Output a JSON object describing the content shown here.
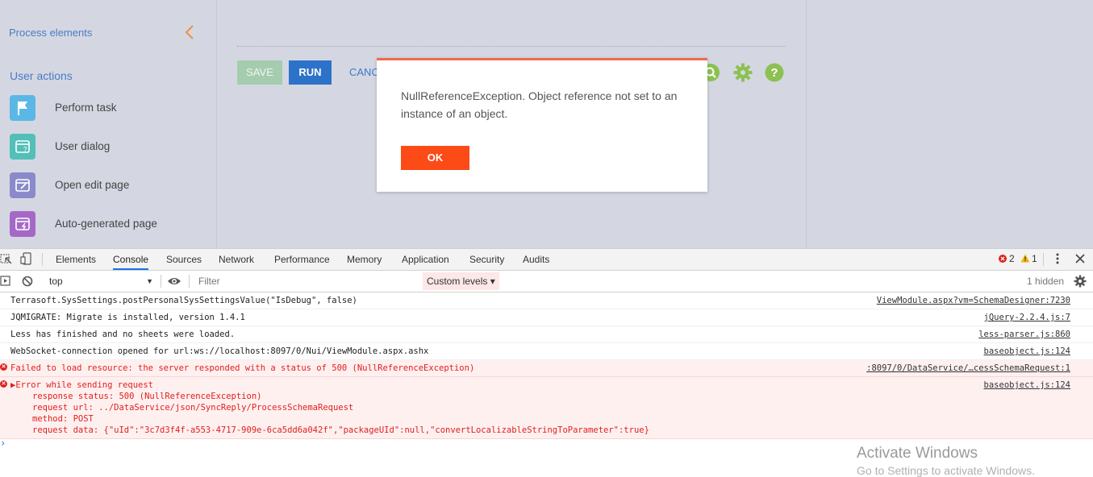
{
  "left_panel": {
    "title": "Process elements",
    "section": "User actions",
    "items": [
      {
        "label": "Perform task",
        "icon": "flag-icon",
        "color": "#5bb8e6"
      },
      {
        "label": "User dialog",
        "icon": "dialog-icon",
        "color": "#52bfb9"
      },
      {
        "label": "Open edit page",
        "icon": "edit-page-icon",
        "color": "#8a8acb"
      },
      {
        "label": "Auto-generated page",
        "icon": "autogen-page-icon",
        "color": "#a668c8"
      }
    ]
  },
  "toolbar": {
    "save_label": "SAVE",
    "run_label": "RUN",
    "cancel_label": "CANC",
    "icons": [
      "search-icon",
      "gear-icon",
      "help-icon"
    ]
  },
  "modal": {
    "message": "NullReferenceException. Object reference not set to an instance of an object.",
    "ok_label": "OK"
  },
  "devtools": {
    "tabs": [
      "Elements",
      "Console",
      "Sources",
      "Network",
      "Performance",
      "Memory",
      "Application",
      "Security",
      "Audits"
    ],
    "active_tab": "Console",
    "error_count": "2",
    "warning_count": "1",
    "context": "top",
    "filter_placeholder": "Filter",
    "levels_label": "Custom levels ▾",
    "hidden_label": "1 hidden",
    "logs": [
      {
        "msg": "Terrasoft.SysSettings.postPersonalSysSettingsValue(\"IsDebug\", false)",
        "src": "ViewModule.aspx?vm=SchemaDesigner:7230"
      },
      {
        "msg": "JQMIGRATE: Migrate is installed, version 1.4.1",
        "src": "jQuery-2.2.4.js:7"
      },
      {
        "msg": "Less has finished and no sheets were loaded.",
        "src": "less-parser.js:860"
      },
      {
        "msg": "WebSocket-connection opened for url:ws://localhost:8097/0/Nui/ViewModule.aspx.ashx",
        "src": "baseobject.js:124"
      },
      {
        "msg": "Failed to load resource: the server responded with a status of 500 (NullReferenceException)",
        "src": ":8097/0/DataService/…cessSchemaRequest:1"
      }
    ],
    "error_entry": {
      "title": "▶Error while sending request",
      "src": "baseobject.js:124",
      "lines": [
        "response status: 500 (NullReferenceException)",
        "request url: ../DataService/json/SyncReply/ProcessSchemaRequest",
        "method: POST",
        "request data: {\"uId\":\"3c7d3f4f-a553-4717-909e-6ca5dd6a042f\",\"packageUId\":null,\"convertLocalizableStringToParameter\":true}"
      ]
    },
    "prompt": "›"
  },
  "watermark": {
    "line1": "Activate Windows",
    "line2": "Go to Settings to activate Windows."
  }
}
